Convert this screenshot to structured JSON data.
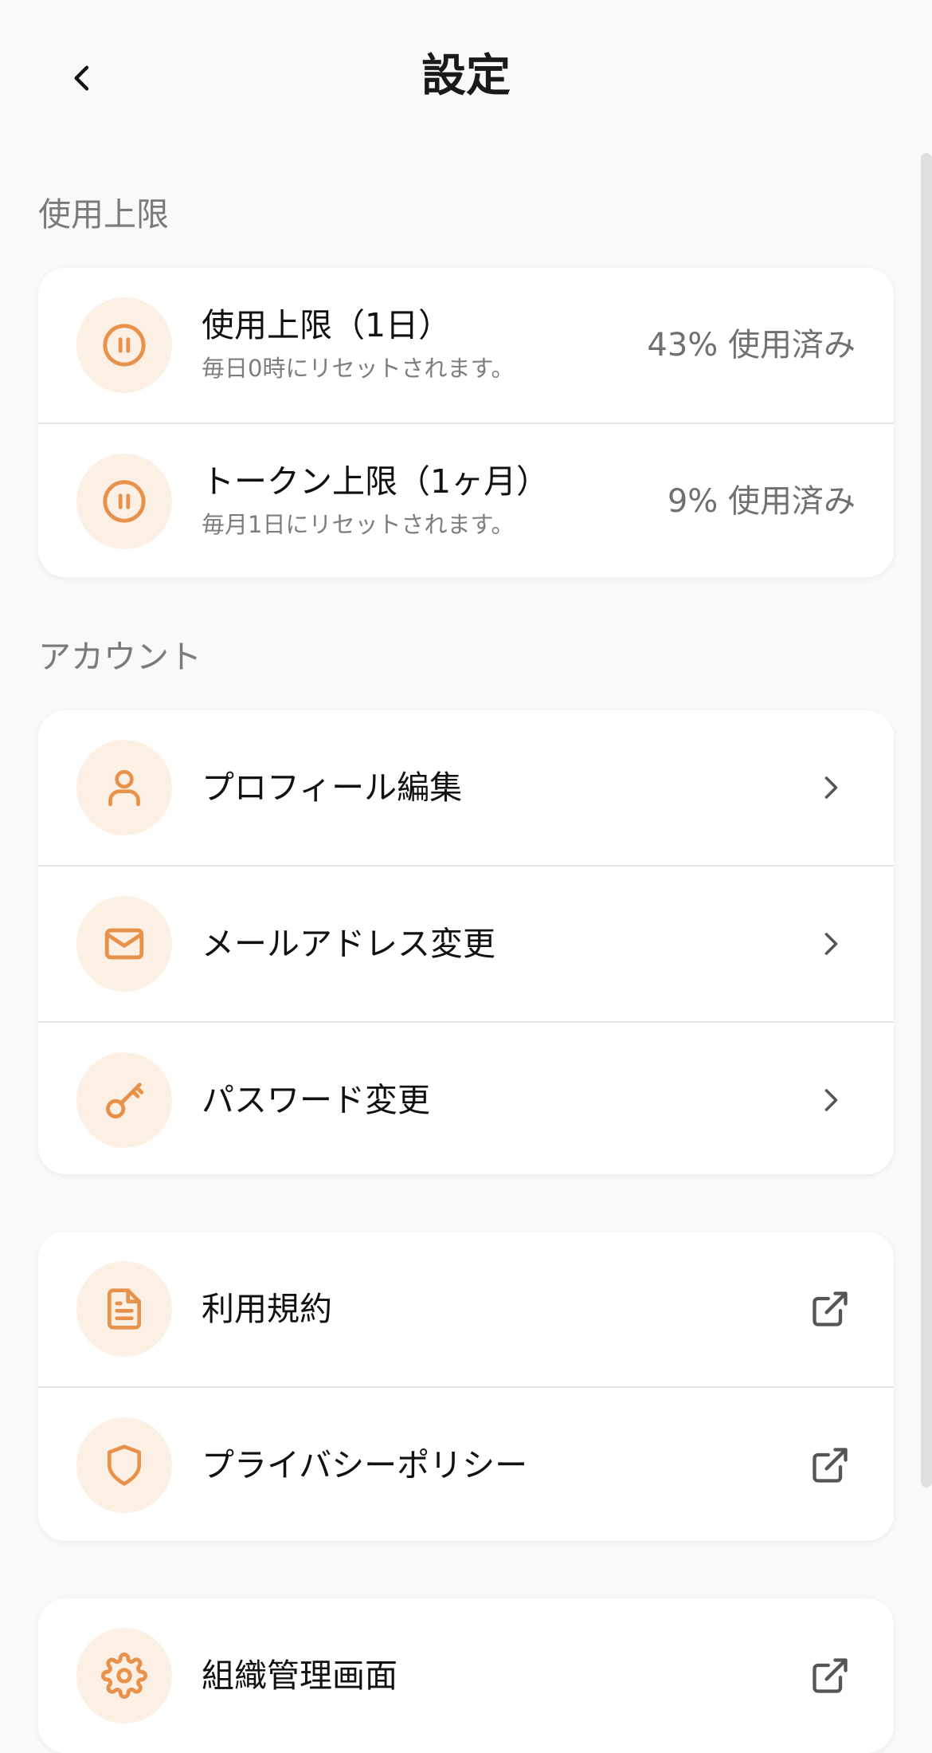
{
  "header": {
    "title": "設定"
  },
  "usage_section": {
    "label": "使用上限",
    "items": [
      {
        "title": "使用上限（1日）",
        "subtitle": "毎日0時にリセットされます。",
        "percent": 43,
        "value": "43% 使用済み",
        "icon": "pause-circle-icon"
      },
      {
        "title": "トークン上限（1ヶ月）",
        "subtitle": "毎月1日にリセットされます。",
        "percent": 9,
        "value": "9% 使用済み",
        "icon": "pause-circle-icon"
      }
    ]
  },
  "account_section": {
    "label": "アカウント",
    "items": [
      {
        "label": "プロフィール編集",
        "icon": "user-icon"
      },
      {
        "label": "メールアドレス変更",
        "icon": "mail-icon"
      },
      {
        "label": "パスワード変更",
        "icon": "key-icon"
      }
    ]
  },
  "legal_section": {
    "items": [
      {
        "label": "利用規約",
        "icon": "document-icon"
      },
      {
        "label": "プライバシーポリシー",
        "icon": "shield-icon"
      }
    ]
  },
  "org_section": {
    "items": [
      {
        "label": "組織管理画面",
        "icon": "gear-icon"
      }
    ]
  },
  "colors": {
    "accent": "#e8914a",
    "icon_bg": "#fcefe3",
    "background": "#f8f9fb"
  }
}
